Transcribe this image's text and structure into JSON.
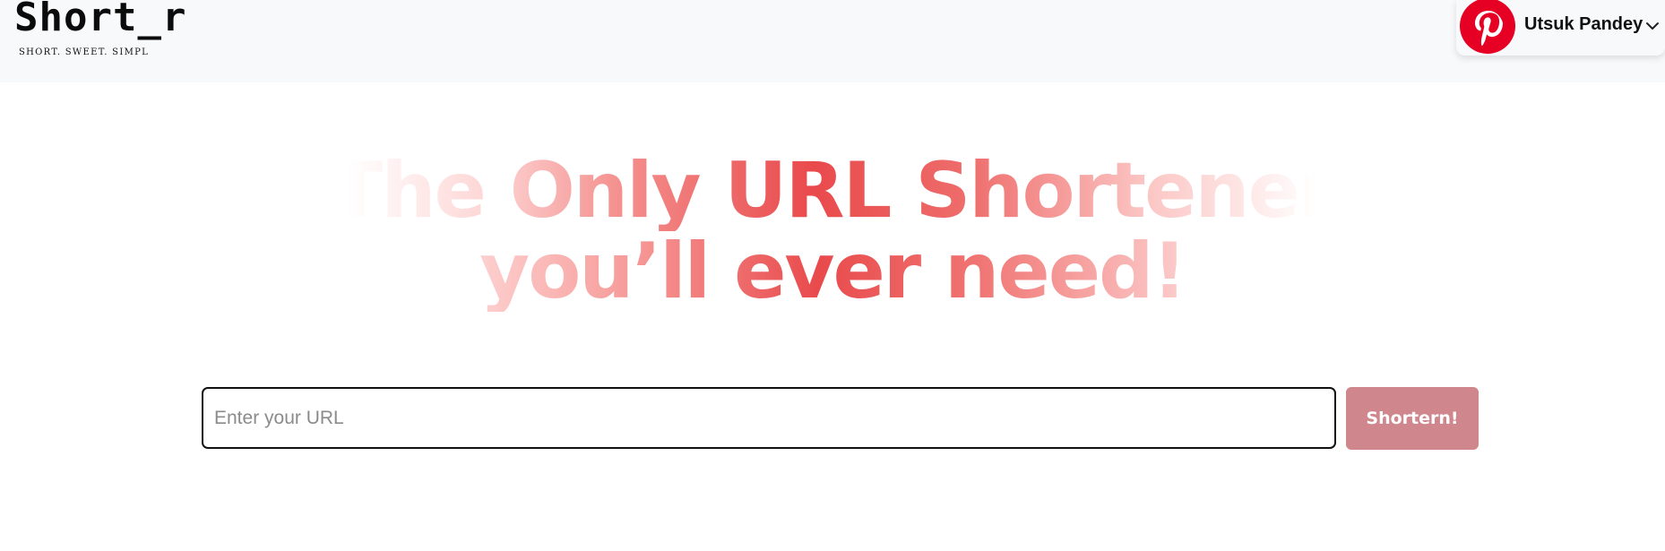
{
  "brand": {
    "logo_text": "Short_r",
    "tagline": "SHORT. SWEET. SIMPL"
  },
  "user": {
    "name": "Utsuk Pandey",
    "avatar_icon": "pinterest-logo-icon",
    "avatar_color": "#e60023",
    "menu_icon": "chevron-down-icon"
  },
  "hero": {
    "line1": "The Only URL Shortener",
    "line2": "you’ll ever need!",
    "accent_color": "#e94a4c"
  },
  "form": {
    "url_placeholder": "Enter your URL",
    "url_value": "",
    "submit_label": "Shortern!",
    "submit_color": "#d0868d"
  }
}
